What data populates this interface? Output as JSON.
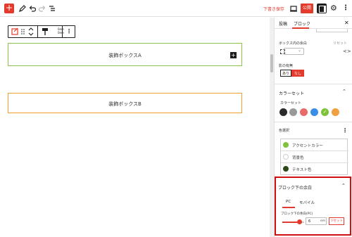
{
  "topbar": {
    "add_icon_label": "+",
    "draft_label": "下書き保存",
    "publish_label": "公開"
  },
  "block_toolbar": {
    "padding_top": "0em",
    "padding_bottom": "0em"
  },
  "canvas": {
    "box_a_label": "装飾ボックスA",
    "box_b_label": "装飾ボックスB",
    "box_a_border": "#8ac44a",
    "box_b_border": "#f0a030"
  },
  "sidebar": {
    "tabs": [
      {
        "label": "投稿"
      },
      {
        "label": "ブロック"
      }
    ],
    "inner_padding_label": "ボックス内の余白",
    "reset_label": "リセット",
    "shadow_label": "影の有無",
    "shadow_off": "あり",
    "shadow_on": "なし",
    "color_set_title": "カラーセット",
    "color_set_label": "カラーセット",
    "swatches": [
      "#2a2a2a",
      "#999999",
      "#e86a6a",
      "#3a8ee6",
      "#7ec23a",
      "#f0a040"
    ],
    "color_select_title": "色選択",
    "colors": [
      {
        "label": "アクセントカラー",
        "color": "#7ec23a"
      },
      {
        "label": "背景色",
        "color": "#ffffff"
      },
      {
        "label": "テキスト色",
        "color": "#2a4a1a"
      }
    ],
    "bottom_margin_title": "ブロック下の余白",
    "sub_tabs": [
      {
        "label": "PC"
      },
      {
        "label": "モバイル"
      }
    ],
    "bottom_margin_pc_label": "ブロック下の余白(PC)",
    "range_value": "6",
    "range_unit": "em",
    "range_reset": "リセット"
  }
}
